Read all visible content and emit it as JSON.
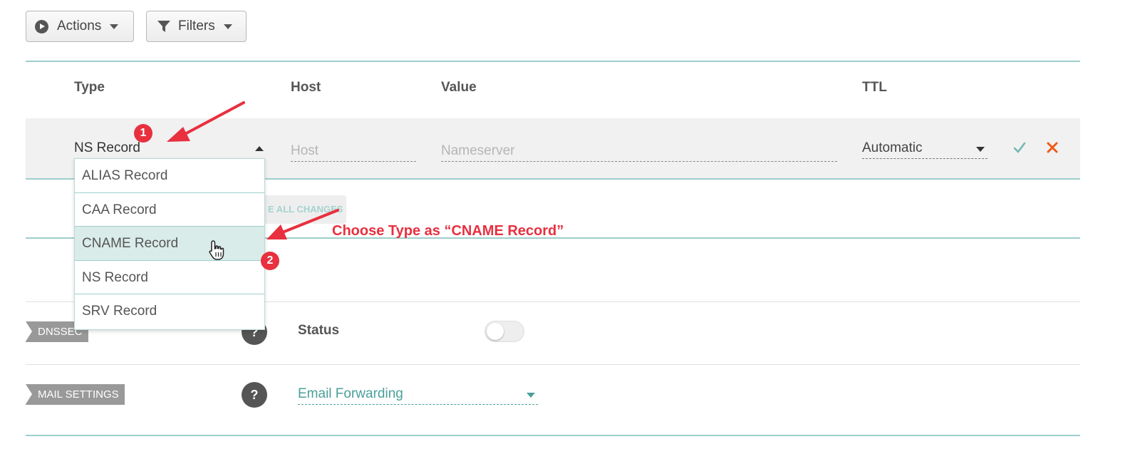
{
  "toolbar": {
    "actions_label": "Actions",
    "filters_label": "Filters"
  },
  "table": {
    "columns": [
      "Type",
      "Host",
      "Value",
      "TTL"
    ]
  },
  "edit_row": {
    "type_value": "NS Record",
    "host_placeholder": "Host",
    "value_placeholder": "Nameserver",
    "ttl_value": "Automatic"
  },
  "type_dropdown": {
    "options": [
      "ALIAS Record",
      "CAA Record",
      "CNAME Record",
      "NS Record",
      "SRV Record"
    ],
    "highlighted": "CNAME Record"
  },
  "save_all_label": "E ALL CHANGES",
  "dnssec": {
    "tag": "DNSSEC",
    "status_label": "Status",
    "status_on": false
  },
  "mail_settings": {
    "tag": "MAIL SETTINGS",
    "help_glyph": "?",
    "option": "Email Forwarding"
  },
  "annotations": {
    "step1": "1",
    "step2": "2",
    "instruction": "Choose Type as “CNAME Record”"
  },
  "colors": {
    "accent_teal": "#9ccfcb",
    "cancel_orange": "#f05a1a",
    "confirm_teal": "#6fb8b2",
    "annotation_red": "#e8303f"
  },
  "icons": [
    "play-circle-icon",
    "filter-icon",
    "caret-down-icon",
    "caret-up-icon",
    "check-icon",
    "close-icon",
    "help-icon",
    "hand-pointer-icon",
    "arrow-icon"
  ]
}
